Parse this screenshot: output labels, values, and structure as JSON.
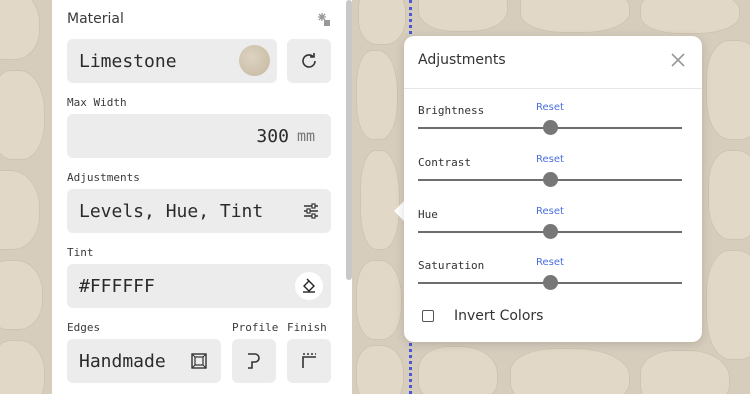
{
  "material": {
    "title": "Material",
    "name": "Limestone",
    "max_width_label": "Max Width",
    "max_width_value": "300",
    "max_width_unit": "mm",
    "adjustments_label": "Adjustments",
    "adjustments_value": "Levels, Hue, Tint",
    "tint_label": "Tint",
    "tint_value": "#FFFFFF",
    "edges_label": "Edges",
    "edges_value": "Handmade",
    "profile_label": "Profile",
    "finish_label": "Finish"
  },
  "popover": {
    "title": "Adjustments",
    "rows": [
      {
        "name": "Brightness",
        "reset": "Reset",
        "value": 0.5
      },
      {
        "name": "Contrast",
        "reset": "Reset",
        "value": 0.5
      },
      {
        "name": "Hue",
        "reset": "Reset",
        "value": 0.5
      },
      {
        "name": "Saturation",
        "reset": "Reset",
        "value": 0.5
      }
    ],
    "invert_label": "Invert Colors",
    "invert_checked": false
  },
  "colors": {
    "accent": "#4a6ee0",
    "field_bg": "#ececec",
    "panel_bg": "#ffffff"
  }
}
